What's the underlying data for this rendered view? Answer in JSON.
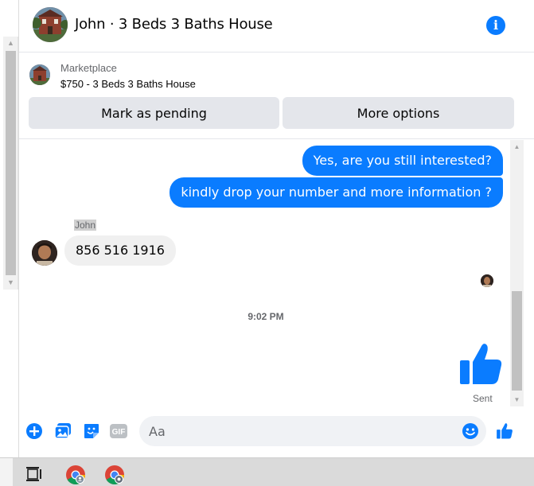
{
  "header": {
    "title": "John · 3 Beds 3 Baths House",
    "info_icon": "info-icon"
  },
  "marketplace": {
    "label": "Marketplace",
    "listing": "$750 - 3 Beds 3 Baths House",
    "pending_button": "Mark as pending",
    "more_button": "More options"
  },
  "messages": {
    "outgoing": [
      "Yes, are you still interested?",
      "kindly drop your number and more information ?"
    ],
    "sender_name": "John",
    "incoming": "856 516 1916",
    "timestamp": "9:02 PM",
    "sent_label": "Sent"
  },
  "composer": {
    "placeholder": "Aa",
    "gif_label": "GIF"
  },
  "colors": {
    "accent": "#0a7cff",
    "bubble_in": "#f0f0f0",
    "button_bg": "#e4e6eb"
  }
}
